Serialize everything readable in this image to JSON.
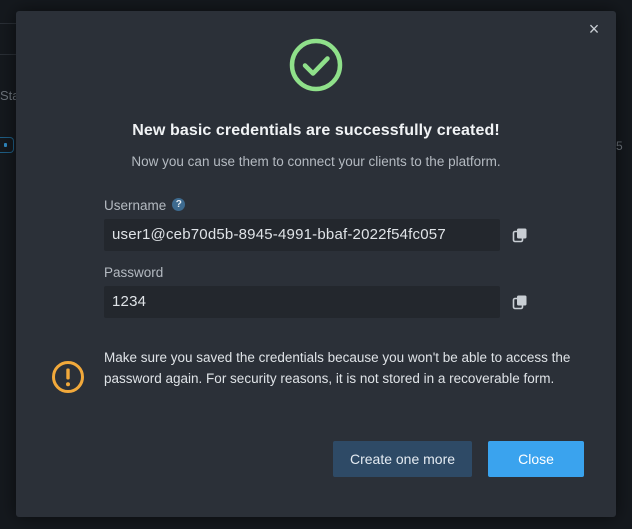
{
  "background": {
    "fragment_left": "Sta",
    "fragment_right": "5"
  },
  "dialog": {
    "close_glyph": "×",
    "title": "New basic credentials are successfully created!",
    "subtitle": "Now you can use them to connect your clients to the platform.",
    "username": {
      "label": "Username",
      "help_glyph": "?",
      "value": "user1@ceb70d5b-8945-4991-bbaf-2022f54fc057"
    },
    "password": {
      "label": "Password",
      "value": "1234"
    },
    "warning": "Make sure you saved the credentials because you won't be able to access the password again. For security reasons, it is not stored in a recoverable form.",
    "buttons": {
      "create_more": "Create one more",
      "close": "Close"
    }
  },
  "icons": {
    "success": "check-circle-icon",
    "warning": "exclamation-circle-icon",
    "copy": "copy-icon",
    "close": "close-icon",
    "help": "help-icon"
  },
  "colors": {
    "success": "#8fe08a",
    "warning": "#f2a93b",
    "primary": "#3aa3ee",
    "secondary": "#2e4a66",
    "dialog_bg": "#2b3038"
  }
}
